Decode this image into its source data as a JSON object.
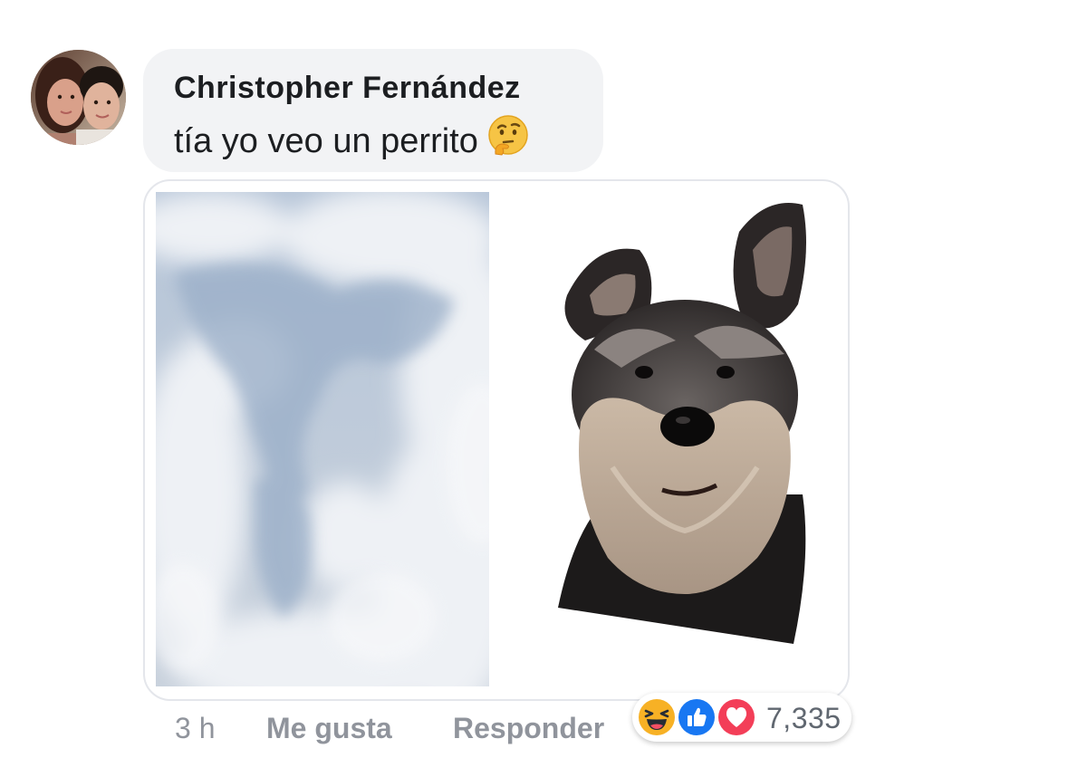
{
  "comment": {
    "author": "Christopher Fernández",
    "text": "tía yo veo un perrito",
    "emoji": "thinking-face-emoji"
  },
  "attachment": {
    "left_image": "cloud-sky-photo",
    "right_image": "schnauzer-dog-photo"
  },
  "meta": {
    "time": "3 h",
    "like_label": "Me gusta",
    "reply_label": "Responder"
  },
  "reactions": {
    "types": [
      "haha-icon",
      "like-icon",
      "love-icon"
    ],
    "count": "7,335",
    "colors": {
      "haha": "#f7b125",
      "like": "#1877f2",
      "love": "#f33e58"
    }
  }
}
